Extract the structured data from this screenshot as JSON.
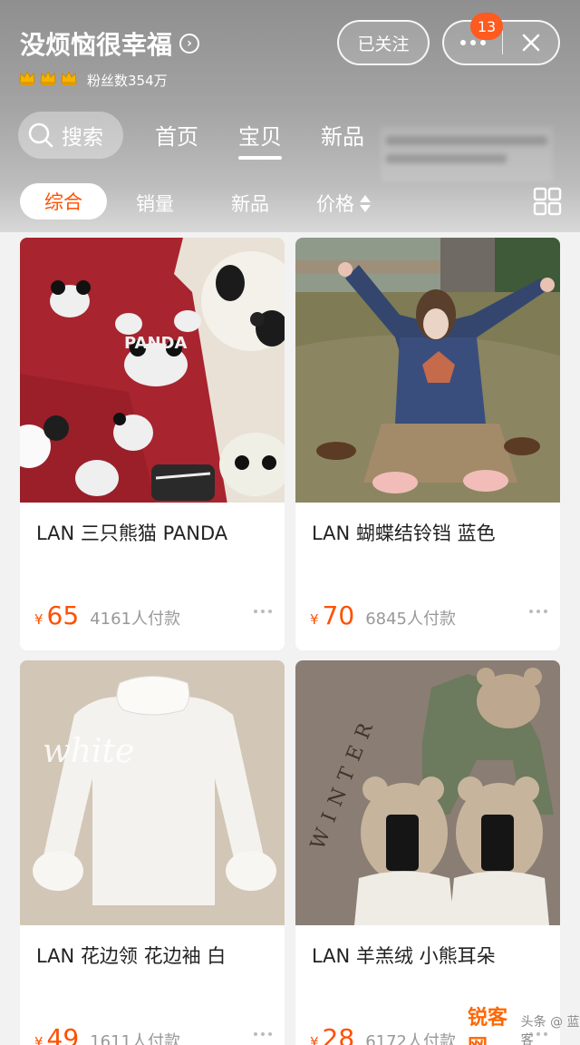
{
  "header": {
    "shop_name": "没烦恼很幸福",
    "fans_label": "粉丝数354万",
    "follow_label": "已关注",
    "notification_count": "13"
  },
  "nav": {
    "search_label": "搜索",
    "tabs": [
      {
        "label": "首页"
      },
      {
        "label": "宝贝",
        "active": true
      },
      {
        "label": "新品"
      }
    ]
  },
  "filters": {
    "items": [
      {
        "label": "综合",
        "active": true
      },
      {
        "label": "销量"
      },
      {
        "label": "新品"
      },
      {
        "label": "价格"
      }
    ]
  },
  "products": [
    {
      "title": "LAN 三只熊猫 PANDA",
      "currency": "¥",
      "price": "65",
      "sold": "4161人付款"
    },
    {
      "title": "LAN 蝴蝶结铃铛 蓝色",
      "currency": "¥",
      "price": "70",
      "sold": "6845人付款"
    },
    {
      "title": "LAN 花边领 花边袖 白",
      "currency": "¥",
      "price": "49",
      "sold": "1611人付款"
    },
    {
      "title": "LAN 羊羔绒 小熊耳朵",
      "currency": "¥",
      "price": "28",
      "sold": "6172人付款"
    }
  ],
  "photo_text": {
    "panda_sweater": "PANDA",
    "white_sweater": "white",
    "winter": "WINTER"
  },
  "watermark": {
    "brand": "锐客网",
    "sub": "头条 @ 蓝客"
  },
  "colors": {
    "accent": "#ff5000",
    "header": "#a3a3a3"
  }
}
